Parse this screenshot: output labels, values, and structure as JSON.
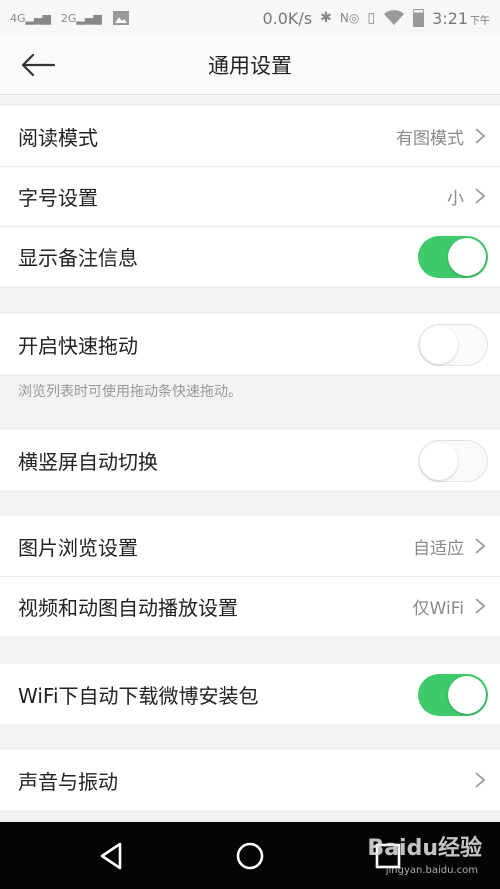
{
  "status_bar": {
    "sim1": "4G",
    "sim2": "2G",
    "net_speed": "0.0K/s",
    "time": "3:21",
    "ampm": "下午"
  },
  "header": {
    "title": "通用设置"
  },
  "settings": {
    "reading_mode": {
      "label": "阅读模式",
      "value": "有图模式"
    },
    "font_size": {
      "label": "字号设置",
      "value": "小"
    },
    "show_remark": {
      "label": "显示备注信息",
      "on": true
    },
    "fast_drag": {
      "label": "开启快速拖动",
      "on": false,
      "hint": "浏览列表时可使用拖动条快速拖动。"
    },
    "auto_rotate": {
      "label": "横竖屏自动切换",
      "on": false
    },
    "image_browse": {
      "label": "图片浏览设置",
      "value": "自适应"
    },
    "video_autoplay": {
      "label": "视频和动图自动播放设置",
      "value": "仅WiFi"
    },
    "wifi_download": {
      "label": "WiFi下自动下载微博安装包",
      "on": true
    },
    "sound_vibration": {
      "label": "声音与振动"
    }
  },
  "watermark": {
    "text": "Baidu经验",
    "sub": "jingyan.baidu.com"
  },
  "colors": {
    "toggle_on": "#3ec96a",
    "background": "#f2f2f2",
    "nav_bar": "#050505"
  }
}
